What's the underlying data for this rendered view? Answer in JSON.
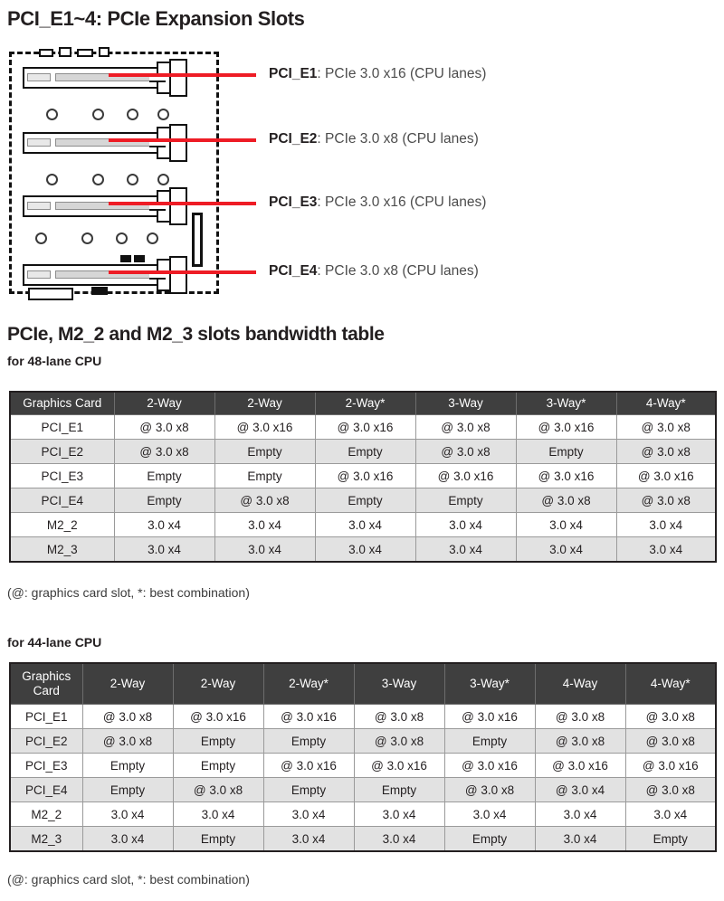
{
  "section": {
    "title": "PCI_E1~4: PCIe Expansion Slots"
  },
  "diagram": {
    "name": "pcie-slot-layout-diagram",
    "callouts": [
      {
        "slot": "PCI_E1",
        "sep": ": ",
        "spec": "PCIe 3.0 x16 (CPU lanes)"
      },
      {
        "slot": "PCI_E2",
        "sep": ": ",
        "spec": "PCIe 3.0 x8 (CPU lanes)"
      },
      {
        "slot": "PCI_E3",
        "sep": ": ",
        "spec": "PCIe 3.0 x16 (CPU lanes)"
      },
      {
        "slot": "PCI_E4",
        "sep": ": ",
        "spec": "PCIe 3.0 x8 (CPU lanes)"
      }
    ],
    "leader_color": "#ee1c25"
  },
  "bandwidth": {
    "title": "PCIe, M2_2 and M2_3 slots bandwidth table",
    "footnote": "(@: graphics card slot, *: best combination)",
    "table48": {
      "subtitle": "for 48-lane CPU",
      "columns": [
        "Graphics Card",
        "2-Way",
        "2-Way",
        "2-Way*",
        "3-Way",
        "3-Way*",
        "4-Way*"
      ],
      "rows": [
        {
          "label": "PCI_E1",
          "cells": [
            "@ 3.0 x8",
            "@ 3.0 x16",
            "@ 3.0 x16",
            "@ 3.0 x8",
            "@ 3.0 x16",
            "@ 3.0 x8"
          ]
        },
        {
          "label": "PCI_E2",
          "cells": [
            "@ 3.0 x8",
            "Empty",
            "Empty",
            "@ 3.0 x8",
            "Empty",
            "@ 3.0 x8"
          ]
        },
        {
          "label": "PCI_E3",
          "cells": [
            "Empty",
            "Empty",
            "@ 3.0 x16",
            "@ 3.0 x16",
            "@ 3.0 x16",
            "@ 3.0 x16"
          ]
        },
        {
          "label": "PCI_E4",
          "cells": [
            "Empty",
            "@ 3.0 x8",
            "Empty",
            "Empty",
            "@ 3.0 x8",
            "@ 3.0 x8"
          ]
        },
        {
          "label": "M2_2",
          "cells": [
            "3.0 x4",
            "3.0 x4",
            "3.0 x4",
            "3.0 x4",
            "3.0 x4",
            "3.0 x4"
          ]
        },
        {
          "label": "M2_3",
          "cells": [
            "3.0 x4",
            "3.0 x4",
            "3.0 x4",
            "3.0 x4",
            "3.0 x4",
            "3.0 x4"
          ]
        }
      ]
    },
    "table44": {
      "subtitle": "for 44-lane CPU",
      "columns": [
        "Graphics Card",
        "2-Way",
        "2-Way",
        "2-Way*",
        "3-Way",
        "3-Way*",
        "4-Way",
        "4-Way*"
      ],
      "rows": [
        {
          "label": "PCI_E1",
          "cells": [
            "@ 3.0 x8",
            "@ 3.0 x16",
            "@ 3.0 x16",
            "@ 3.0 x8",
            "@ 3.0 x16",
            "@ 3.0 x8",
            "@ 3.0 x8"
          ]
        },
        {
          "label": "PCI_E2",
          "cells": [
            "@ 3.0 x8",
            "Empty",
            "Empty",
            "@ 3.0 x8",
            "Empty",
            "@ 3.0 x8",
            "@ 3.0 x8"
          ]
        },
        {
          "label": "PCI_E3",
          "cells": [
            "Empty",
            "Empty",
            "@ 3.0 x16",
            "@ 3.0 x16",
            "@ 3.0 x16",
            "@ 3.0 x16",
            "@ 3.0 x16"
          ]
        },
        {
          "label": "PCI_E4",
          "cells": [
            "Empty",
            "@ 3.0 x8",
            "Empty",
            "Empty",
            "@ 3.0 x8",
            "@ 3.0 x4",
            "@ 3.0 x8"
          ]
        },
        {
          "label": "M2_2",
          "cells": [
            "3.0 x4",
            "3.0 x4",
            "3.0 x4",
            "3.0 x4",
            "3.0 x4",
            "3.0 x4",
            "3.0 x4"
          ]
        },
        {
          "label": "M2_3",
          "cells": [
            "3.0 x4",
            "Empty",
            "3.0 x4",
            "3.0 x4",
            "Empty",
            "3.0 x4",
            "Empty"
          ]
        }
      ]
    }
  },
  "colors": {
    "header_bg": "#3f3f3f",
    "alt_row_bg": "#e2e2e2",
    "accent_red": "#ee1c25",
    "text": "#231f20"
  }
}
